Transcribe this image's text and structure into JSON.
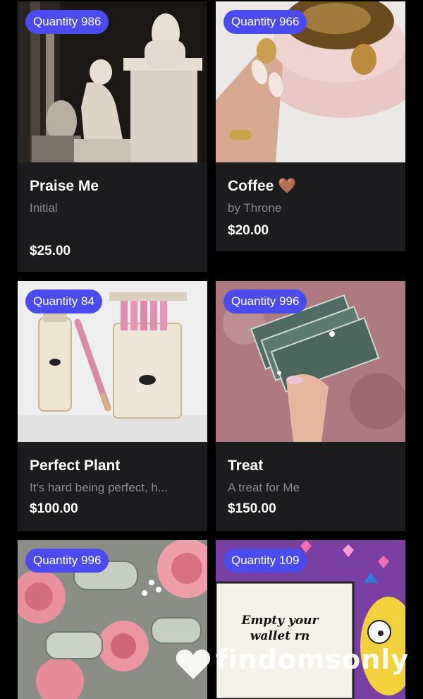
{
  "products": [
    {
      "badge": "Quantity 986",
      "title": "Praise Me",
      "subtitle": "Initial",
      "price": "$25.00",
      "image_icon": "marble-statue-photo"
    },
    {
      "badge": "Quantity 966",
      "title": "Coffee 🤎",
      "subtitle": "by Throne",
      "price": "$20.00",
      "image_icon": "coffee-cup-photo"
    },
    {
      "badge": "Quantity 84",
      "title": "Perfect Plant",
      "subtitle": "It's hard being perfect, h...",
      "price": "$100.00",
      "image_icon": "lighter-and-box-photo"
    },
    {
      "badge": "Quantity 996",
      "title": "Treat",
      "subtitle": "A treat for Me",
      "price": "$150.00",
      "image_icon": "cash-in-hand-photo"
    },
    {
      "badge": "Quantity 996",
      "title": "",
      "subtitle": "",
      "price": "",
      "image_icon": "roses-and-money-photo"
    },
    {
      "badge": "Quantity 109",
      "title": "",
      "subtitle": "",
      "price": "",
      "image_icon": "cartoon-sign-photo",
      "image_text": "Empty your wallet rn"
    }
  ],
  "watermark": {
    "text": "findomsonly",
    "icon": "heart-icon"
  },
  "colors": {
    "background": "#000000",
    "card": "#1c1c1e",
    "badge": "#4b4bf0",
    "subtitle": "#8a8a8e"
  }
}
